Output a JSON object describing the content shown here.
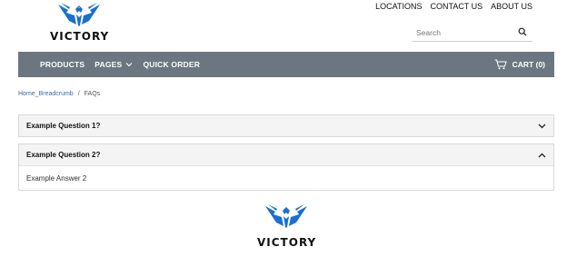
{
  "brand": {
    "name": "VICTORY",
    "accent": "#1a6fd1"
  },
  "header": {
    "util_links": [
      "LOCATIONS",
      "CONTACT US",
      "ABOUT US"
    ],
    "search": {
      "placeholder": "Search",
      "value": ""
    }
  },
  "nav": {
    "items": [
      {
        "label": "PRODUCTS",
        "dropdown": false
      },
      {
        "label": "PAGES",
        "dropdown": true
      },
      {
        "label": "QUICK ORDER",
        "dropdown": false
      }
    ],
    "cart_label": "CART (0)",
    "background": "#6b7680"
  },
  "breadcrumb": {
    "home": "Home_Breadcrumb",
    "separator": "/",
    "current": "FAQs"
  },
  "faq": [
    {
      "question": "Example Question 1?",
      "expanded": false,
      "answer": ""
    },
    {
      "question": "Example Question 2?",
      "expanded": true,
      "answer": "Example Answer 2"
    }
  ],
  "footer": {
    "brand_name": "VICTORY"
  }
}
